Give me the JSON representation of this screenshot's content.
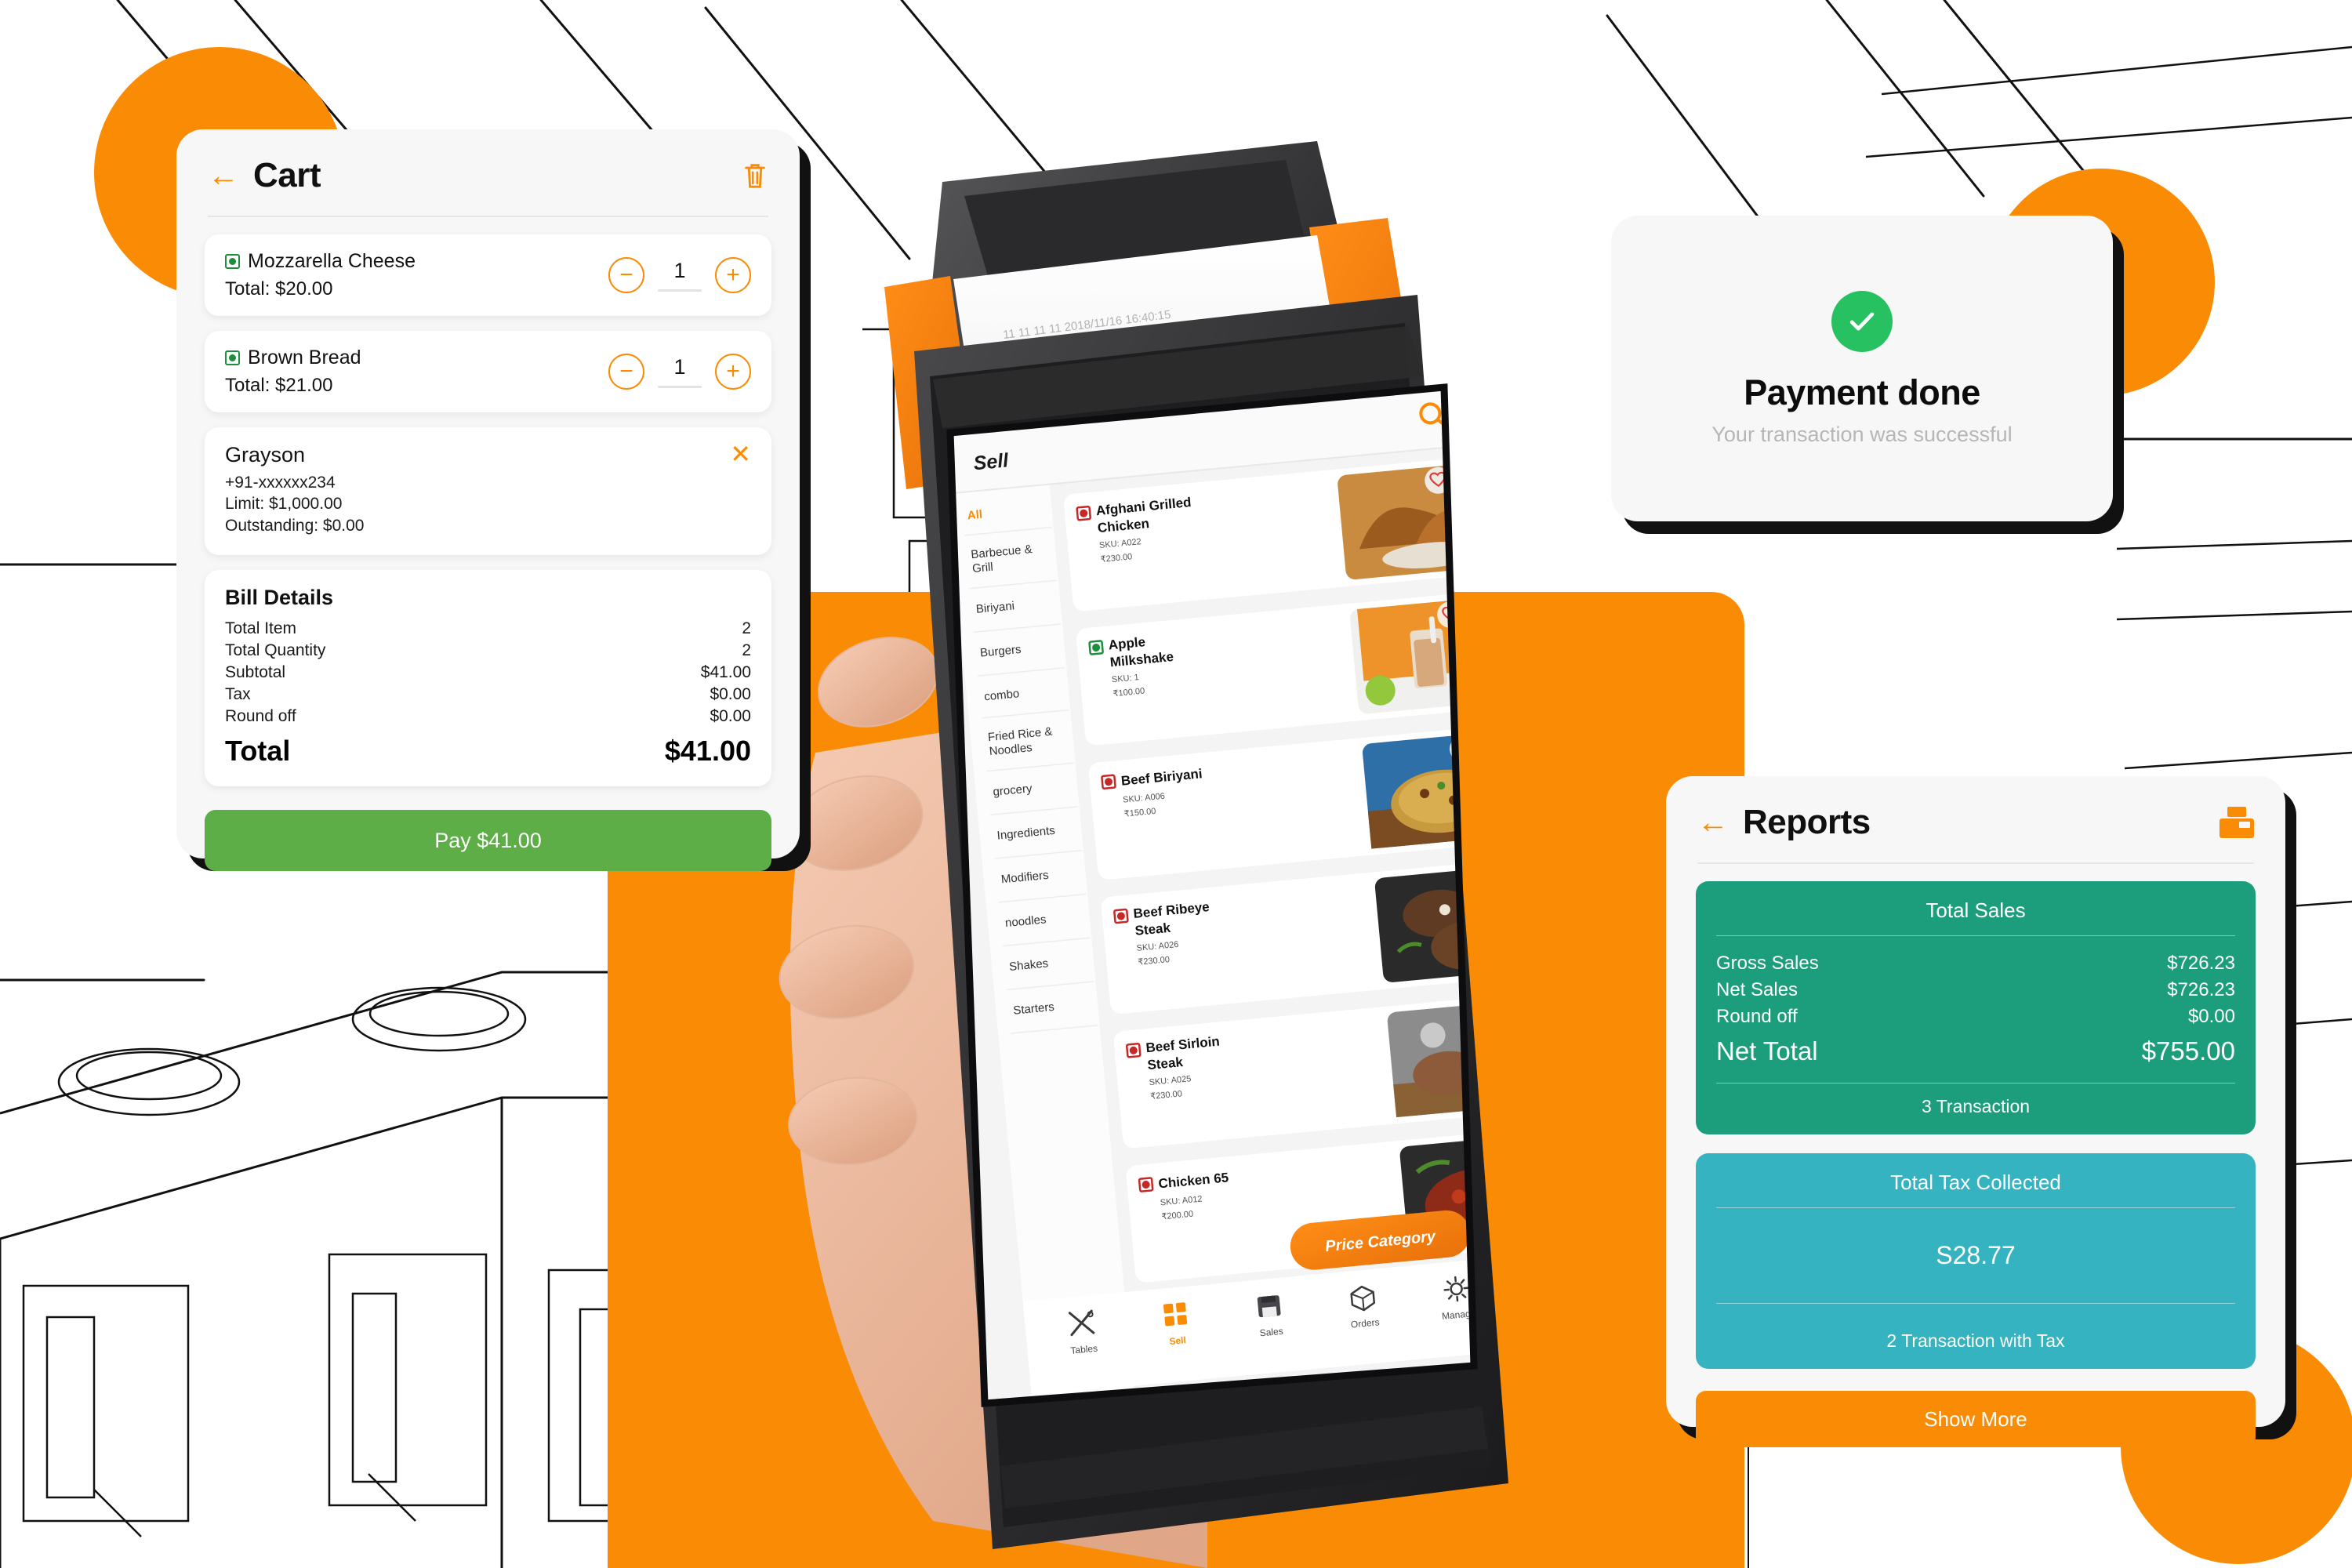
{
  "background": {
    "style": "restaurant-interior-line-sketch"
  },
  "theme": {
    "accent_orange": "#FA8C05",
    "pay_green": "#5DAE47",
    "success_green": "#27C161",
    "sales_teal": "#1C9E7C",
    "tax_teal": "#35B3C0",
    "card_bg": "#F7F7F7",
    "shadow_black": "#111111"
  },
  "cart": {
    "title": "Cart",
    "back_icon": "back-arrow-icon",
    "delete_icon": "trash-icon",
    "items": [
      {
        "name": "Mozzarella Cheese",
        "total_label": "Total: $20.00",
        "qty": "1",
        "diet": "veg",
        "minus": "−",
        "plus": "+"
      },
      {
        "name": "Brown Bread",
        "total_label": "Total: $21.00",
        "qty": "1",
        "diet": "veg",
        "minus": "−",
        "plus": "+"
      }
    ],
    "customer": {
      "name": "Grayson",
      "phone": "+91-xxxxxx234",
      "limit": "Limit: $1,000.00",
      "outstanding": "Outstanding: $0.00",
      "close_icon": "close-icon"
    },
    "bill": {
      "title": "Bill Details",
      "rows": [
        {
          "label": "Total Item",
          "value": "2"
        },
        {
          "label": "Total Quantity",
          "value": "2"
        },
        {
          "label": "Subtotal",
          "value": "$41.00"
        },
        {
          "label": "Tax",
          "value": "$0.00"
        },
        {
          "label": "Round off",
          "value": "$0.00"
        }
      ],
      "grand_label": "Total",
      "grand_value": "$41.00"
    },
    "pay_button": "Pay $41.00"
  },
  "payment": {
    "icon": "check-circle-icon",
    "title": "Payment done",
    "subtitle": "Your transaction was successful"
  },
  "reports": {
    "title": "Reports",
    "back_icon": "back-arrow-icon",
    "print_icon": "printer-icon",
    "total_sales": {
      "heading": "Total Sales",
      "rows": [
        {
          "label": "Gross Sales",
          "value": "$726.23"
        },
        {
          "label": "Net Sales",
          "value": "$726.23"
        },
        {
          "label": "Round off",
          "value": "$0.00"
        }
      ],
      "net_total_label": "Net Total",
      "net_total_value": "$755.00",
      "footer": "3 Transaction"
    },
    "total_tax": {
      "heading": "Total Tax Collected",
      "value": "S28.77",
      "footer": "2 Transaction with Tax"
    },
    "show_more": "Show More"
  },
  "device": {
    "screen": {
      "title": "Sell",
      "search_icon": "search-icon",
      "categories": [
        {
          "label": "All",
          "active": true
        },
        {
          "label": "Barbecue & Grill",
          "active": false
        },
        {
          "label": "Biriyani",
          "active": false
        },
        {
          "label": "Burgers",
          "active": false
        },
        {
          "label": "combo",
          "active": false
        },
        {
          "label": "Fried Rice & Noodles",
          "active": false
        },
        {
          "label": "grocery",
          "active": false
        },
        {
          "label": "Ingredients",
          "active": false
        },
        {
          "label": "Modifiers",
          "active": false
        },
        {
          "label": "noodles",
          "active": false
        },
        {
          "label": "Shakes",
          "active": false
        },
        {
          "label": "Starters",
          "active": false
        }
      ],
      "products": [
        {
          "name": "Afghani Grilled Chicken",
          "sku": "SKU: A022",
          "price": "₹230.00",
          "diet": "nonveg"
        },
        {
          "name": "Apple Milkshake",
          "sku": "SKU: 1",
          "price": "₹100.00",
          "diet": "veg"
        },
        {
          "name": "Beef Biriyani",
          "sku": "SKU: A006",
          "price": "₹150.00",
          "diet": "nonveg"
        },
        {
          "name": "Beef Ribeye Steak",
          "sku": "SKU: A026",
          "price": "₹230.00",
          "diet": "nonveg"
        },
        {
          "name": "Beef Sirloin Steak",
          "sku": "SKU: A025",
          "price": "₹230.00",
          "diet": "nonveg"
        },
        {
          "name": "Chicken 65",
          "sku": "SKU: A012",
          "price": "₹200.00",
          "diet": "nonveg"
        }
      ],
      "fab_label": "Price Category",
      "bottom_nav": [
        {
          "label": "Tables",
          "icon": "cutlery-icon",
          "active": false
        },
        {
          "label": "Sell",
          "icon": "grid-icon",
          "active": true
        },
        {
          "label": "Sales",
          "icon": "register-icon",
          "active": false
        },
        {
          "label": "Orders",
          "icon": "box-icon",
          "active": false
        },
        {
          "label": "Manage",
          "icon": "gear-icon",
          "active": false
        }
      ]
    }
  }
}
